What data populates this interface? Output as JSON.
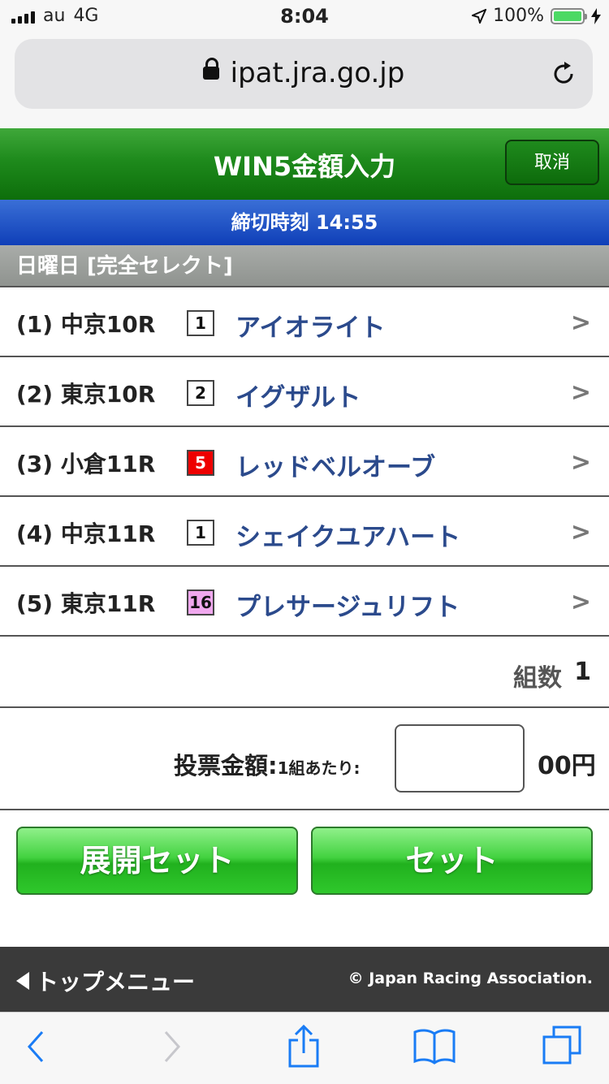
{
  "status_bar": {
    "carrier": "au",
    "network": "4G",
    "time": "8:04",
    "battery": "100%"
  },
  "browser": {
    "url": "ipat.jra.go.jp"
  },
  "header": {
    "title": "WIN5金額入力",
    "cancel_label": "取消"
  },
  "deadline": "締切時刻 14:55",
  "section_title": "日曜日 [完全セレクト]",
  "races": [
    {
      "label": "(1) 中京10R",
      "number": "1",
      "horse": "アイオライト",
      "num_bg": "#ffffff",
      "num_color": "#111111"
    },
    {
      "label": "(2) 東京10R",
      "number": "2",
      "horse": "イグザルト",
      "num_bg": "#ffffff",
      "num_color": "#111111"
    },
    {
      "label": "(3) 小倉11R",
      "number": "5",
      "horse": "レッドベルオーブ",
      "num_bg": "#ee0000",
      "num_color": "#ffffff"
    },
    {
      "label": "(4) 中京11R",
      "number": "1",
      "horse": "シェイクユアハート",
      "num_bg": "#ffffff",
      "num_color": "#111111"
    },
    {
      "label": "(5) 東京11R",
      "number": "16",
      "horse": "プレサージュリフト",
      "num_bg": "#f0a8ee",
      "num_color": "#111111"
    }
  ],
  "combos": {
    "label": "組数",
    "value": "1"
  },
  "amount": {
    "label": "投票金額:",
    "sub_label": "1組あたり:",
    "value": "",
    "unit": "00円"
  },
  "buttons": {
    "expand_set": "展開セット",
    "set": "セット"
  },
  "footer": {
    "top_menu": "トップメニュー",
    "copyright": "© Japan Racing Association."
  },
  "colors": {
    "header_green": "#1e8a1c",
    "deadline_blue": "#1f4fc4",
    "horse_name": "#2b4a8c",
    "button_green": "#43d240"
  },
  "toolbar_icons": [
    "back-icon",
    "forward-icon",
    "share-icon",
    "bookmarks-icon",
    "tabs-icon"
  ]
}
